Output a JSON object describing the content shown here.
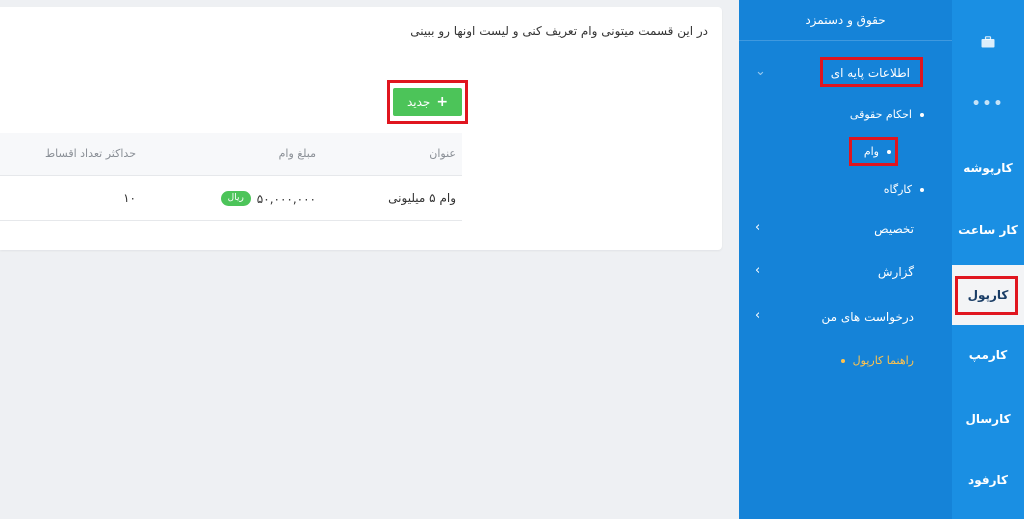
{
  "main": {
    "intro_text": "در این قسمت میتونی وام تعریف کنی و لیست اونها رو ببینی",
    "new_button_label": "جدید",
    "table": {
      "headers": [
        "عنوان",
        "مبلغ وام",
        "حداکثر تعداد اقساط"
      ],
      "rows": [
        {
          "title": "وام ۵ میلیونی",
          "amount": "۵۰,۰۰۰,۰۰۰",
          "currency": "ریال",
          "max_installments": "۱۰"
        }
      ]
    }
  },
  "sidebar": {
    "header": "حقوق و دستمزد",
    "sections": [
      {
        "label": "اطلاعات پایه ای",
        "expanded": true,
        "children": [
          "احکام حقوقی",
          "وام",
          "کارگاه"
        ]
      },
      {
        "label": "تخصیص"
      },
      {
        "label": "گزارش"
      },
      {
        "label": "درخواست های من"
      }
    ],
    "guide": "راهنما کارپول"
  },
  "rail": {
    "items": [
      "کارپوشه",
      "کار ساعت",
      "کارپول",
      "کارمپ",
      "کارسال",
      "کارفود"
    ],
    "active": "کارپول"
  },
  "colors": {
    "rail_bg": "#1a8fe3",
    "sidebar_bg": "#1583d8",
    "accent_green": "#4cc459",
    "highlight_red": "#e0151f",
    "guide_orange": "#ffc34d"
  }
}
